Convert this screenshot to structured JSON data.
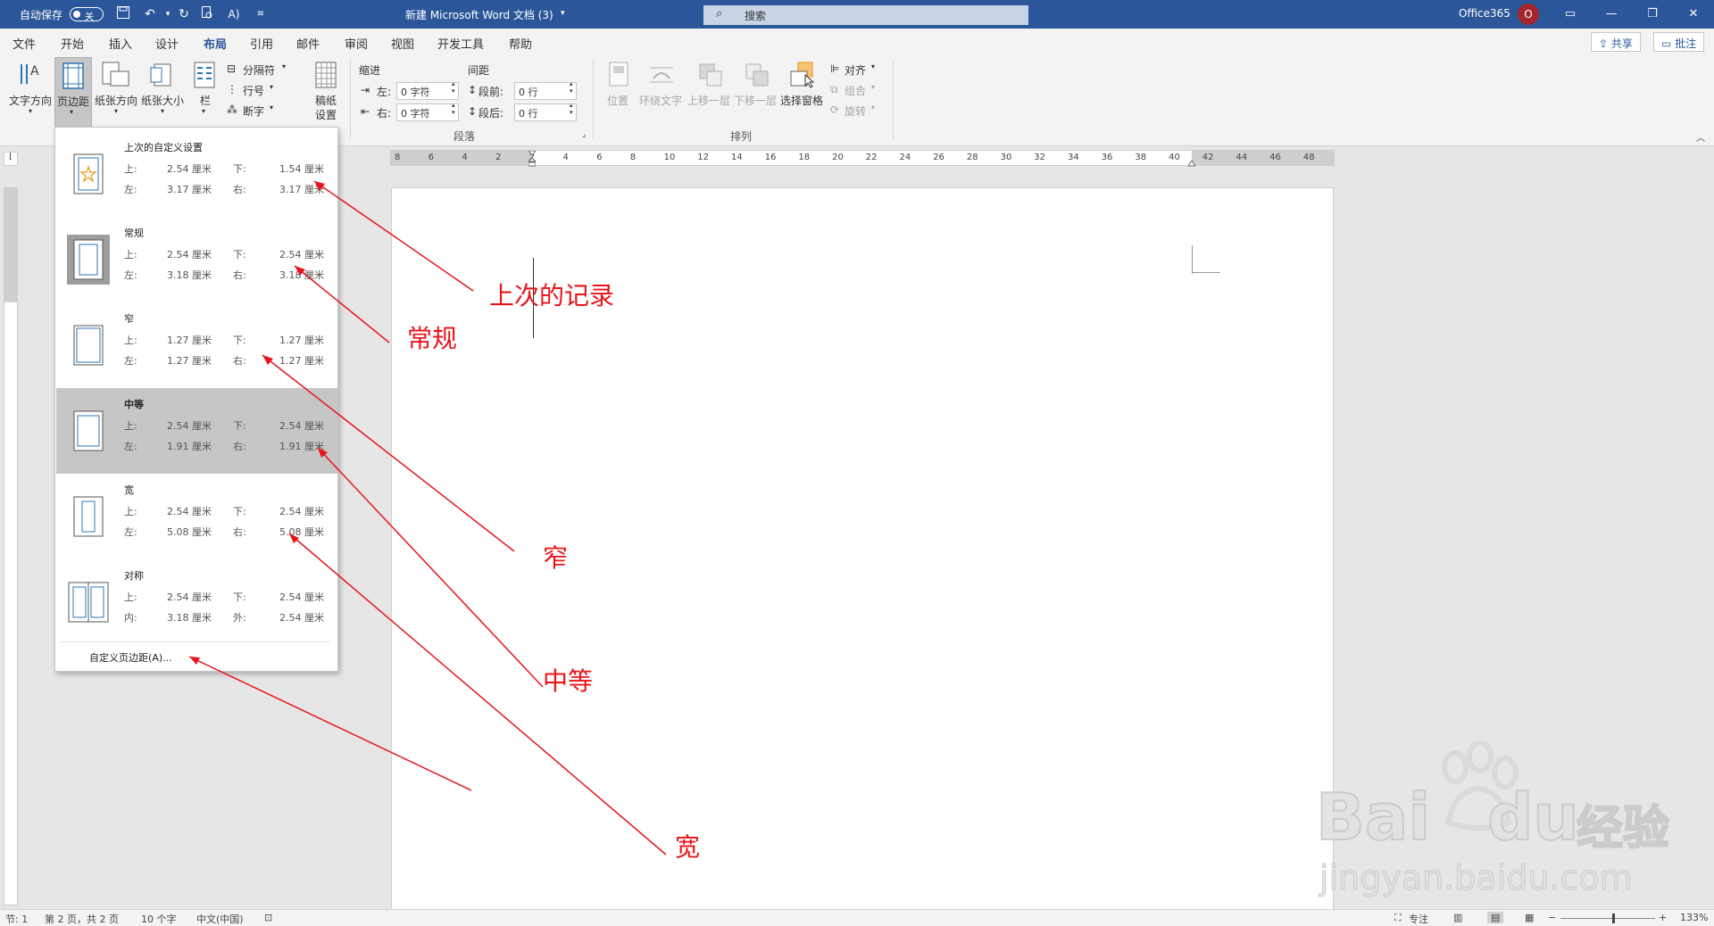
{
  "titlebar": {
    "autosave_label": "自动保存",
    "autosave_state": "关",
    "doc_title": "新建 Microsoft Word 文档 (3)",
    "search_placeholder": "搜索",
    "account": "Office365",
    "avatar_letter": "O"
  },
  "tabs": [
    "文件",
    "开始",
    "插入",
    "设计",
    "布局",
    "引用",
    "邮件",
    "审阅",
    "视图",
    "开发工具",
    "帮助"
  ],
  "active_tab": "布局",
  "share_label": "共享",
  "comment_label": "批注",
  "ribbon": {
    "text_direction": "文字方向",
    "margins": "页边距",
    "orientation": "纸张方向",
    "size": "纸张大小",
    "columns": "栏",
    "breaks": "分隔符",
    "line_numbers": "行号",
    "hyphenation": "断字",
    "draft_paper": "稿纸",
    "draft_paper2": "设置",
    "indent": "缩进",
    "indent_left_label": "左:",
    "indent_left_value": "0 字符",
    "indent_right_label": "右:",
    "indent_right_value": "0 字符",
    "spacing": "间距",
    "spacing_before_label": "段前:",
    "spacing_before_value": "0 行",
    "spacing_after_label": "段后:",
    "spacing_after_value": "0 行",
    "paragraph_group": "段落",
    "position": "位置",
    "wrap_text": "环绕文字",
    "bring_forward": "上移一层",
    "send_backward": "下移一层",
    "selection_pane": "选择窗格",
    "align": "对齐",
    "group": "组合",
    "rotate": "旋转",
    "arrange_group": "排列"
  },
  "ruler_numbers": [
    "8",
    "6",
    "4",
    "2",
    "2",
    "4",
    "6",
    "8",
    "10",
    "12",
    "14",
    "16",
    "18",
    "20",
    "22",
    "24",
    "26",
    "28",
    "30",
    "32",
    "34",
    "36",
    "38",
    "40",
    "42",
    "44",
    "46",
    "48"
  ],
  "margins_menu": [
    {
      "name": "上次的自定义设置",
      "k1": "上:",
      "v1": "2.54 厘米",
      "k2": "下:",
      "v2": "1.54 厘米",
      "k3": "左:",
      "v3": "3.17 厘米",
      "k4": "右:",
      "v4": "3.17 厘米",
      "icon": "star",
      "selected": false
    },
    {
      "name": "常规",
      "k1": "上:",
      "v1": "2.54 厘米",
      "k2": "下:",
      "v2": "2.54 厘米",
      "k3": "左:",
      "v3": "3.18 厘米",
      "k4": "右:",
      "v4": "3.18 厘米",
      "icon": "normal",
      "selected": false
    },
    {
      "name": "窄",
      "k1": "上:",
      "v1": "1.27 厘米",
      "k2": "下:",
      "v2": "1.27 厘米",
      "k3": "左:",
      "v3": "1.27 厘米",
      "k4": "右:",
      "v4": "1.27 厘米",
      "icon": "narrow",
      "selected": false
    },
    {
      "name": "中等",
      "k1": "上:",
      "v1": "2.54 厘米",
      "k2": "下:",
      "v2": "2.54 厘米",
      "k3": "左:",
      "v3": "1.91 厘米",
      "k4": "右:",
      "v4": "1.91 厘米",
      "icon": "moderate",
      "selected": true
    },
    {
      "name": "宽",
      "k1": "上:",
      "v1": "2.54 厘米",
      "k2": "下:",
      "v2": "2.54 厘米",
      "k3": "左:",
      "v3": "5.08 厘米",
      "k4": "右:",
      "v4": "5.08 厘米",
      "icon": "wide",
      "selected": false
    },
    {
      "name": "对称",
      "k1": "上:",
      "v1": "2.54 厘米",
      "k2": "下:",
      "v2": "2.54 厘米",
      "k3": "内:",
      "v3": "3.18 厘米",
      "k4": "外:",
      "v4": "2.54 厘米",
      "icon": "mirrored",
      "selected": false
    }
  ],
  "custom_margins": "自定义页边距(A)...",
  "annotations": [
    "上次的记录",
    "常规",
    "窄",
    "中等",
    "宽"
  ],
  "status": {
    "section": "节: 1",
    "page": "第 2 页，共 2 页",
    "words": "10 个字",
    "language": "中文(中国)",
    "focus": "专注",
    "zoom": "133%"
  },
  "watermark": {
    "brand": "Bai",
    "brand2": "du",
    "cn": "经验",
    "url": "jingyan.baidu.com"
  }
}
